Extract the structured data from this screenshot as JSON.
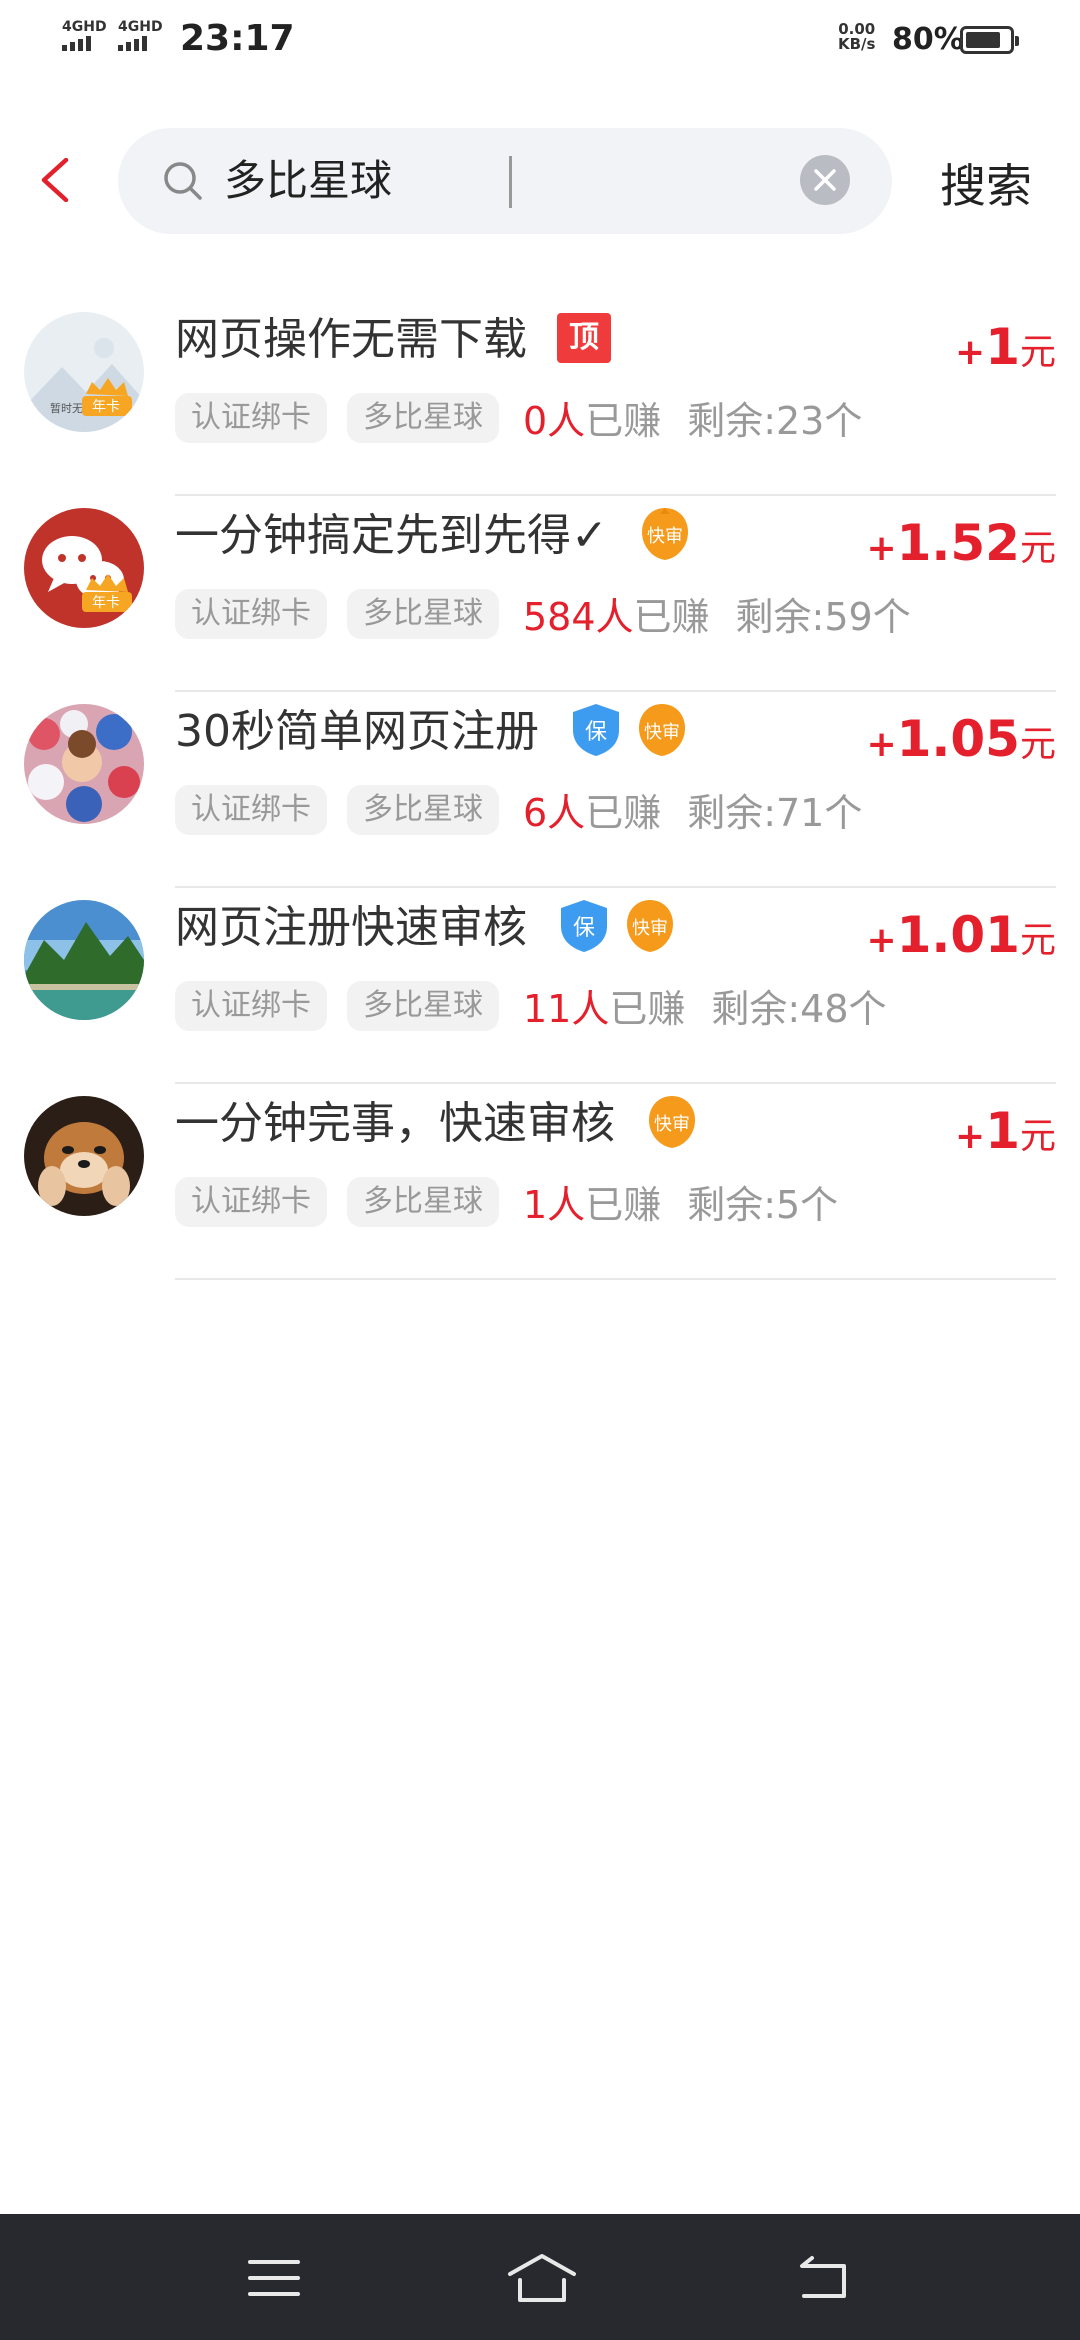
{
  "status_bar": {
    "sig1": "4GHD",
    "sig2": "4GHD",
    "time": "23:17",
    "speed_value": "0.00",
    "speed_unit": "KB/s",
    "battery": "80%",
    "battery_level": 0.8
  },
  "search": {
    "query": "多比星球",
    "submit_label": "搜索"
  },
  "tasks": [
    {
      "title": "网页操作无需下载",
      "badge_top": "顶",
      "price_plus": "+",
      "price": "1",
      "price_unit": "元",
      "tag1": "认证绑卡",
      "tag2": "多比星球",
      "earned_count": "0人",
      "earned_label": "已赚",
      "remaining": "剩余:23个",
      "avatar_text": "暂时无法",
      "vip_label": "年卡"
    },
    {
      "title": "一分钟搞定先到先得✓",
      "badge_kuai": "快审",
      "price_plus": "+",
      "price": "1.52",
      "price_unit": "元",
      "tag1": "认证绑卡",
      "tag2": "多比星球",
      "earned_count": "584人",
      "earned_label": "已赚",
      "remaining": "剩余:59个",
      "vip_label": "年卡"
    },
    {
      "title": "30秒简单网页注册",
      "badge_bao": "保",
      "badge_kuai": "快审",
      "price_plus": "+",
      "price": "1.05",
      "price_unit": "元",
      "tag1": "认证绑卡",
      "tag2": "多比星球",
      "earned_count": "6人",
      "earned_label": "已赚",
      "remaining": "剩余:71个"
    },
    {
      "title": "网页注册快速审核",
      "badge_bao": "保",
      "badge_kuai": "快审",
      "price_plus": "+",
      "price": "1.01",
      "price_unit": "元",
      "tag1": "认证绑卡",
      "tag2": "多比星球",
      "earned_count": "11人",
      "earned_label": "已赚",
      "remaining": "剩余:48个"
    },
    {
      "title": "一分钟完事，快速审核",
      "badge_kuai": "快审",
      "price_plus": "+",
      "price": "1",
      "price_unit": "元",
      "tag1": "认证绑卡",
      "tag2": "多比星球",
      "earned_count": "1人",
      "earned_label": "已赚",
      "remaining": "剩余:5个"
    }
  ],
  "colors": {
    "accent_red": "#e4202d",
    "badge_blue": "#3d9cf0",
    "badge_orange": "#f59a1a",
    "nav_bg": "#27292f"
  },
  "icons": {
    "back": "chevron-left-icon",
    "search": "search-icon",
    "clear": "close-circle-icon",
    "nav_menu": "menu-icon",
    "nav_home": "home-icon",
    "nav_back": "back-icon"
  }
}
